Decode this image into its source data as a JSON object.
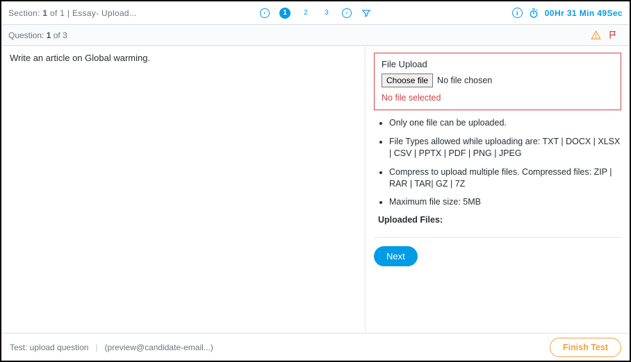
{
  "topbar": {
    "section_prefix": "Section: ",
    "section_current": "1",
    "section_of": " of ",
    "section_total": "1",
    "section_divider": "  |  ",
    "section_name": "Essay- Upload...",
    "pages": [
      "1",
      "2",
      "3"
    ],
    "timer": "00Hr 31 Min 49Sec"
  },
  "question_header": {
    "prefix": "Question:  ",
    "current": "1",
    "of": " of ",
    "total": "3"
  },
  "question_text": "Write an article on Global warming.",
  "upload": {
    "title": "File Upload",
    "choose_label": "Choose file",
    "no_file_chosen": "No file chosen",
    "no_file_selected": "No file selected"
  },
  "rules": [
    "Only one file can be uploaded.",
    "File Types allowed while uploading are: TXT | DOCX | XLSX | CSV | PPTX | PDF | PNG | JPEG",
    "Compress to upload multiple files. Compressed files: ZIP | RAR | TAR| GZ | 7Z",
    "Maximum file size: 5MB"
  ],
  "uploaded_files_label": "Uploaded Files:",
  "next_label": "Next",
  "footer": {
    "test_label": "Test: upload question",
    "email": "(preview@candidate-email...)",
    "finish_label": "Finish Test"
  }
}
